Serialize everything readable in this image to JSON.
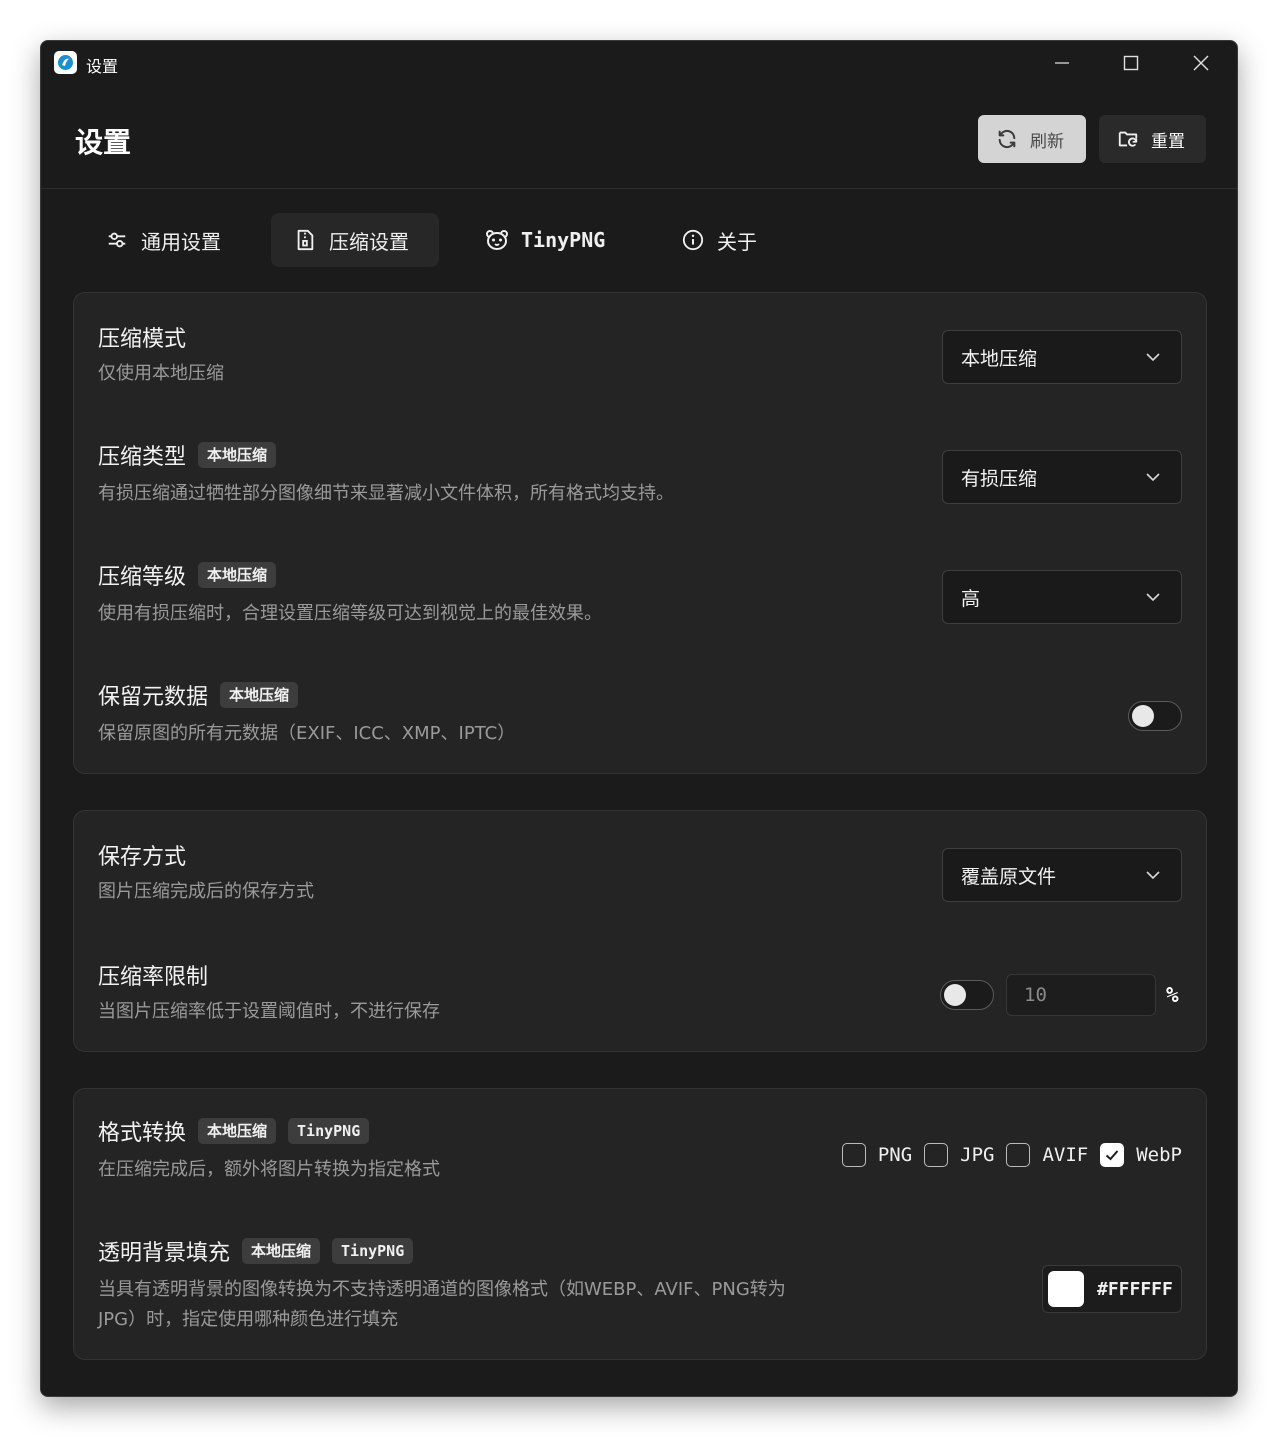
{
  "window": {
    "title": "设置"
  },
  "header": {
    "title": "设置",
    "refresh_label": "刷新",
    "reset_label": "重置"
  },
  "tabs": [
    {
      "label": "通用设置",
      "icon": "sliders-icon"
    },
    {
      "label": "压缩设置",
      "icon": "file-zip-icon",
      "active": true
    },
    {
      "label": "TinyPNG",
      "icon": "panda-icon"
    },
    {
      "label": "关于",
      "icon": "info-icon"
    }
  ],
  "compression": {
    "mode": {
      "title": "压缩模式",
      "desc": "仅使用本地压缩",
      "value": "本地压缩"
    },
    "type": {
      "title": "压缩类型",
      "badge": "本地压缩",
      "desc": "有损压缩通过牺牲部分图像细节来显著减小文件体积，所有格式均支持。",
      "value": "有损压缩"
    },
    "level": {
      "title": "压缩等级",
      "badge": "本地压缩",
      "desc": "使用有损压缩时，合理设置压缩等级可达到视觉上的最佳效果。",
      "value": "高"
    },
    "metadata": {
      "title": "保留元数据",
      "badge": "本地压缩",
      "desc": "保留原图的所有元数据（EXIF、ICC、XMP、IPTC）",
      "enabled": false
    }
  },
  "save": {
    "method": {
      "title": "保存方式",
      "desc": "图片压缩完成后的保存方式",
      "value": "覆盖原文件"
    },
    "ratio": {
      "title": "压缩率限制",
      "desc": "当图片压缩率低于设置阈值时，不进行保存",
      "enabled": false,
      "value": "10",
      "unit": "%"
    }
  },
  "convert": {
    "format": {
      "title": "格式转换",
      "badges": [
        "本地压缩",
        "TinyPNG"
      ],
      "desc": "在压缩完成后，额外将图片转换为指定格式",
      "options": [
        {
          "label": "PNG",
          "checked": false
        },
        {
          "label": "JPG",
          "checked": false
        },
        {
          "label": "AVIF",
          "checked": false
        },
        {
          "label": "WebP",
          "checked": true
        }
      ]
    },
    "fill": {
      "title": "透明背景填充",
      "badges": [
        "本地压缩",
        "TinyPNG"
      ],
      "desc_line1": "当具有透明背景的图像转换为不支持透明通道的图像格式（如WEBP、AVIF、PNG转为",
      "desc_line2": "JPG）时，指定使用哪种颜色进行填充",
      "color": "#FFFFFF"
    }
  }
}
